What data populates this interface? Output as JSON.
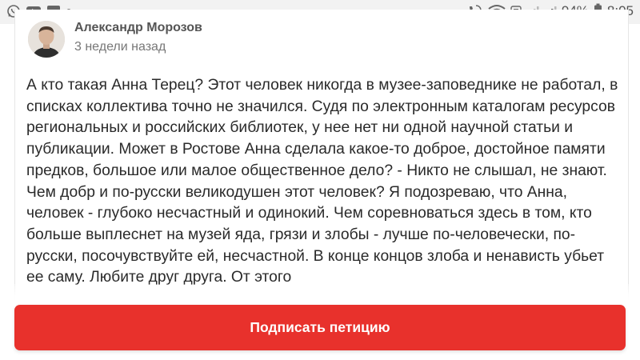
{
  "status_bar": {
    "battery": "94%",
    "time": "8:05",
    "left_icons": [
      "whatsapp-icon",
      "youtube-icon",
      "gallery-icon",
      "more-dots-icon"
    ],
    "right_icons": [
      "call-icon",
      "wifi-icon",
      "volte-icon",
      "signal-icon",
      "signal-icon",
      "battery-icon"
    ]
  },
  "comment": {
    "author": "Александр Морозов",
    "time": "3 недели назад",
    "text": "А кто такая Анна Терец? Этот человек никогда в музее-заповеднике не работал, в списках коллектива точно не значился. Судя по электронным каталогам ресурсов региональных и российских библиотек, у нее нет ни одной научной статьи и публикации. Может в Ростове Анна сделала какое-то доброе, достойное памяти предков, большое или малое общественное дело? - Никто не слышал, не знают. Чем добр и по-русски великодушен этот человек? Я подозреваю, что Анна, человек - глубоко несчастный и одинокий. Чем соревноваться здесь в том, кто больше выплеснет на музей яда, грязи и злобы - лучше по-человечески, по-русски, посочувствуйте ей, несчастной. В конце концов злоба и ненависть убьет ее саму. Любите друг друга. От этого"
  },
  "action": {
    "sign_label": "Подписать петицию"
  },
  "colors": {
    "primary_button": "#e8312c",
    "status_bar_bg": "#f2f2f2"
  }
}
